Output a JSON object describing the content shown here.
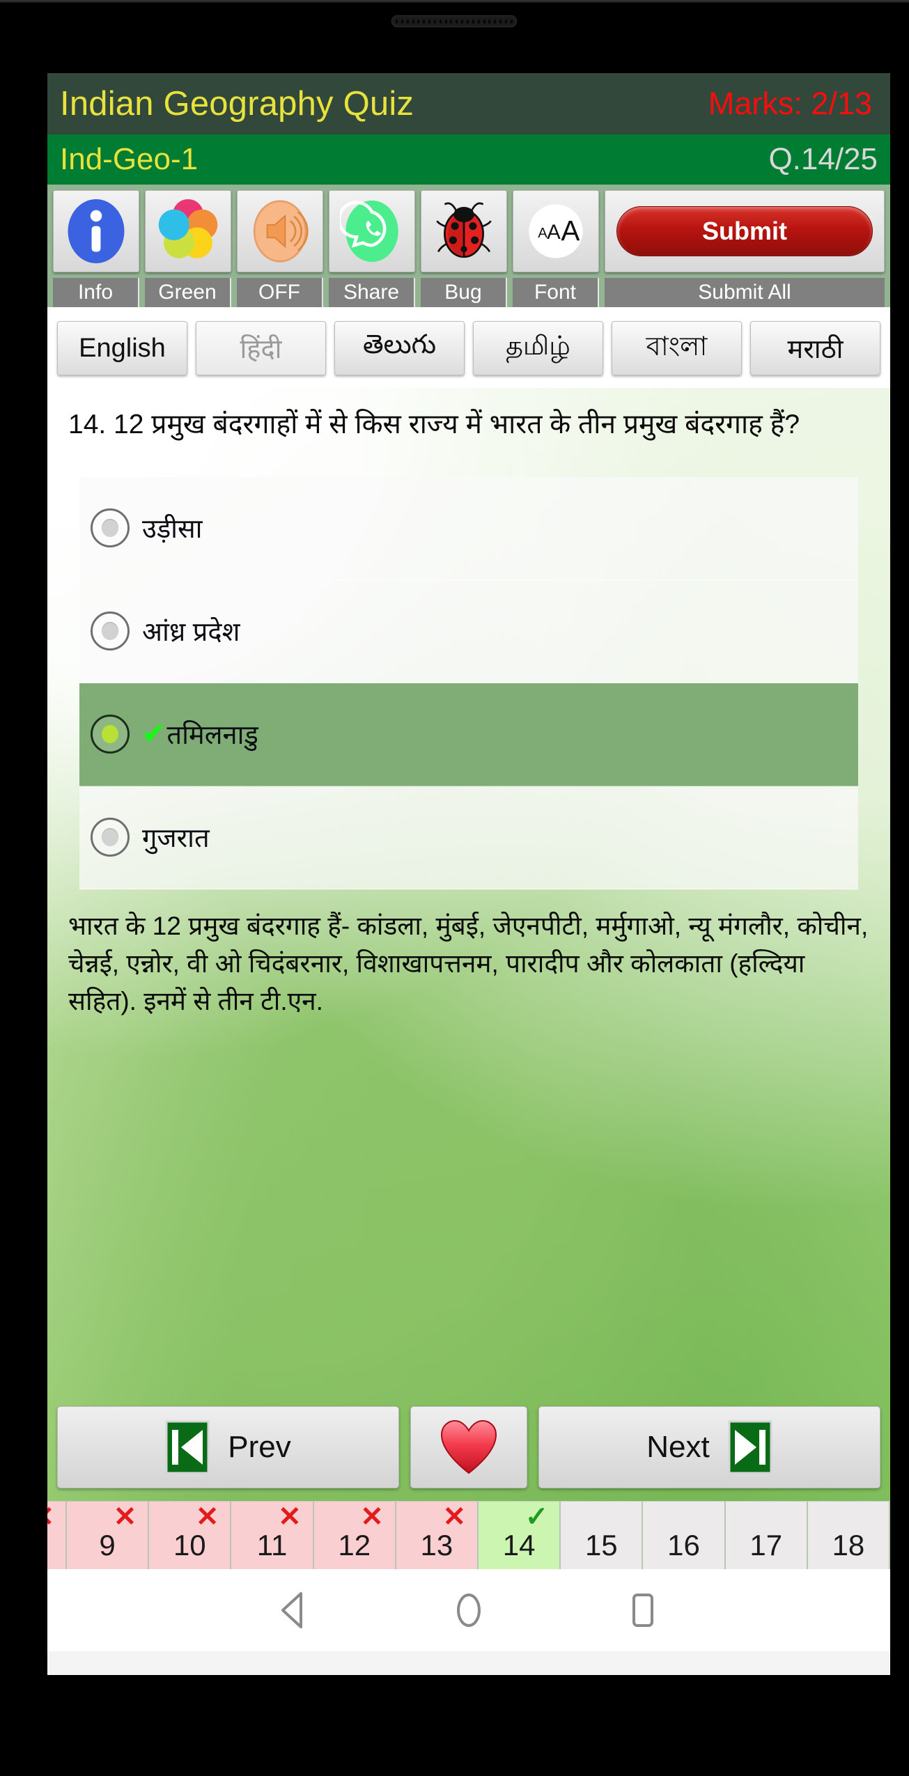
{
  "app": {
    "title": "Indian Geography Quiz",
    "marks_label": "Marks: 2/13",
    "quiz_code": "Ind-Geo-1",
    "question_counter": "Q.14/25"
  },
  "colors": {
    "title_bar_bg": "#31483a",
    "title_text": "#e8e23c",
    "marks_text": "#fa0d0d",
    "sub_bar_bg": "#017c33",
    "toolbar_bg": "#92b491",
    "selected_option_bg": "#7fad75",
    "submit_button": "#c21b17",
    "wrong_cell": "#f9cfd2",
    "current_cell": "#cdf5b2"
  },
  "toolbar": {
    "buttons": [
      {
        "icon": "info-icon",
        "label": "Info"
      },
      {
        "icon": "palette-icon",
        "label": "Green"
      },
      {
        "icon": "speaker-icon",
        "label": "OFF"
      },
      {
        "icon": "whatsapp-icon",
        "label": "Share"
      },
      {
        "icon": "ladybug-icon",
        "label": "Bug"
      },
      {
        "icon": "font-size-icon",
        "label": "Font"
      }
    ],
    "submit_button_label": "Submit",
    "submit_all_label": "Submit All"
  },
  "languages": [
    {
      "label": "English",
      "state": "active"
    },
    {
      "label": "हिंदी",
      "state": "current"
    },
    {
      "label": "తెలుగు",
      "state": "active"
    },
    {
      "label": "தமிழ்",
      "state": "active"
    },
    {
      "label": "বাংলা",
      "state": "active"
    },
    {
      "label": "मराठी",
      "state": "active"
    }
  ],
  "question": {
    "text": "14. 12 प्रमुख बंदरगाहों में से किस राज्य में भारत के तीन प्रमुख बंदरगाह हैं?",
    "options": [
      {
        "label": "उड़ीसा",
        "selected": false,
        "correct": false
      },
      {
        "label": "आंध्र प्रदेश",
        "selected": false,
        "correct": false
      },
      {
        "label": "तमिलनाडु",
        "selected": true,
        "correct": true,
        "tick": "✔"
      },
      {
        "label": "गुजरात",
        "selected": false,
        "correct": false
      }
    ],
    "explanation": "भारत के 12 प्रमुख बंदरगाह हैं- कांडला, मुंबई, जेएनपीटी, मर्मुगाओ, न्यू मंगलौर, कोचीन, चेन्नई, एन्नोर, वी ओ चिदंबरनार, विशाखापत्तनम, पारादीप और कोलकाता (हल्दिया सहित). इनमें से तीन टी.एन."
  },
  "nav": {
    "prev_label": "Prev",
    "next_label": "Next",
    "favorite_icon": "heart-icon",
    "prev_icon": "skip-back-icon",
    "next_icon": "skip-forward-icon"
  },
  "question_strip": [
    {
      "number": "",
      "state": "wrong",
      "mark": "✕",
      "partial": true
    },
    {
      "number": "9",
      "state": "wrong",
      "mark": "✕"
    },
    {
      "number": "10",
      "state": "wrong",
      "mark": "✕"
    },
    {
      "number": "11",
      "state": "wrong",
      "mark": "✕"
    },
    {
      "number": "12",
      "state": "wrong",
      "mark": "✕"
    },
    {
      "number": "13",
      "state": "wrong",
      "mark": "✕"
    },
    {
      "number": "14",
      "state": "current",
      "mark": "✓"
    },
    {
      "number": "15",
      "state": "unanswered",
      "mark": ""
    },
    {
      "number": "16",
      "state": "unanswered",
      "mark": ""
    },
    {
      "number": "17",
      "state": "unanswered",
      "mark": ""
    },
    {
      "number": "18",
      "state": "unanswered",
      "mark": ""
    }
  ],
  "android_nav": [
    {
      "icon": "back-triangle-icon"
    },
    {
      "icon": "home-circle-icon"
    },
    {
      "icon": "recents-square-icon"
    }
  ]
}
